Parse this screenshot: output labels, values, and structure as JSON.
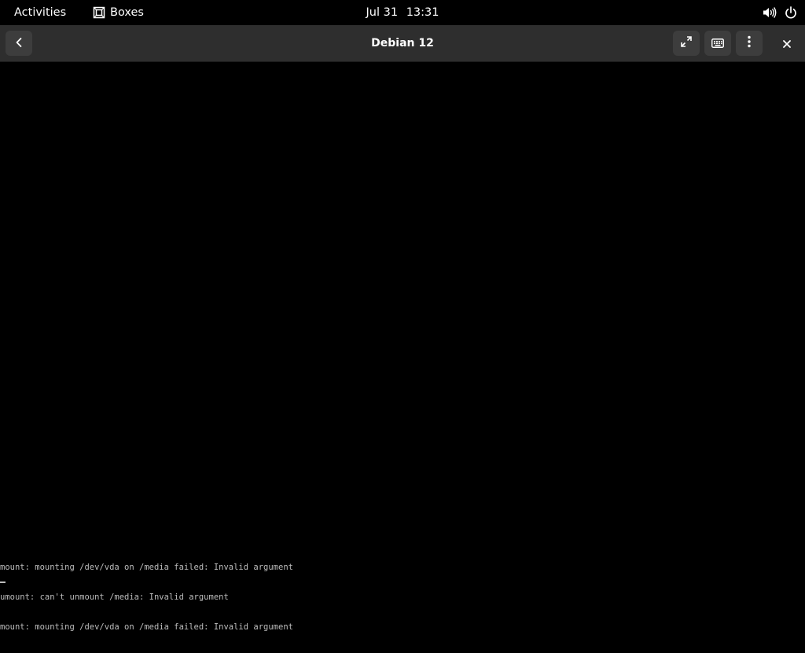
{
  "top_bar": {
    "activities_label": "Activities",
    "app_name": "Boxes",
    "app_icon": "boxes-icon",
    "date": "Jul 31",
    "time": "13:31",
    "volume_icon": "volume-icon",
    "power_icon": "power-icon"
  },
  "header_bar": {
    "title": "Debian 12",
    "back_icon": "chevron-left-icon",
    "fullscreen_icon": "fullscreen-icon",
    "keyboard_icon": "keyboard-icon",
    "menu_icon": "vertical-dots-icon",
    "close_icon": "close-icon"
  },
  "console": {
    "lines": [
      "mount: mounting /dev/vda on /media failed: Invalid argument",
      "umount: can't unmount /media: Invalid argument",
      "mount: mounting /dev/vda on /media failed: Invalid argument"
    ]
  },
  "colors": {
    "top_bar_bg": "#000000",
    "header_bg": "#2e2e2e",
    "button_bg": "#3d3d3d",
    "console_text": "#bdbdbd"
  }
}
